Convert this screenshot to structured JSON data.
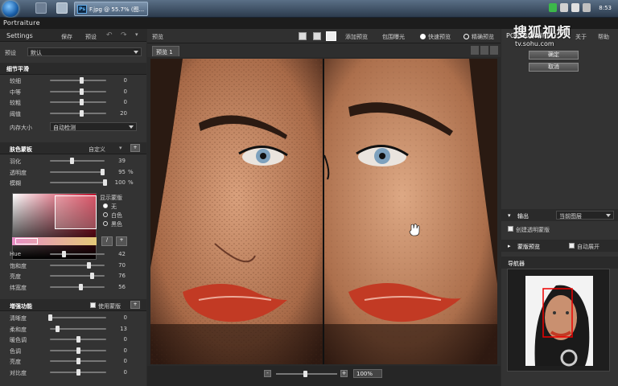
{
  "taskbar": {
    "active_task": "F.jpg @ 55.7% (图...",
    "ps_badge": "Ps",
    "clock": "8:53"
  },
  "app": {
    "title": "Portraiture"
  },
  "settings": {
    "title": "Settings",
    "save": "保存",
    "preset_btn": "预设",
    "preset_label": "预设",
    "preset_value": "默认",
    "detail_header": "细节平滑",
    "detail_sliders": [
      {
        "label": "较细",
        "value": 0,
        "pct": 0.55
      },
      {
        "label": "中等",
        "value": 0,
        "pct": 0.55
      },
      {
        "label": "较粗",
        "value": 0,
        "pct": 0.55
      },
      {
        "label": "阈值",
        "value": 20,
        "pct": 0.55
      }
    ],
    "feature_label": "内存大小",
    "feature_value": "自动检测",
    "mask_header": "肤色蒙板",
    "mask_mode": "自定义",
    "mask_sliders": [
      {
        "label": "羽化",
        "value": 39,
        "unit": "",
        "pct": 0.39
      },
      {
        "label": "透明度",
        "value": 95,
        "unit": "%",
        "pct": 0.95
      },
      {
        "label": "模糊",
        "value": 100,
        "unit": "%",
        "pct": 1.0
      }
    ],
    "show_mask_label": "显示蒙版",
    "show_mask_options": [
      "无",
      "白色",
      "黑色"
    ],
    "show_mask_selected": 0,
    "hsl_sliders": [
      {
        "label": "Hue",
        "value": 42,
        "pct": 0.25
      },
      {
        "label": "饱和度",
        "value": 70,
        "pct": 0.7
      },
      {
        "label": "亮度",
        "value": 76,
        "pct": 0.76
      },
      {
        "label": "纬宽度",
        "value": 56,
        "pct": 0.56
      }
    ],
    "enhance_header": "增强功能",
    "use_mask_label": "使用蒙版",
    "enhance_sliders": [
      {
        "label": "清晰度",
        "value": 0,
        "pct": 0.0
      },
      {
        "label": "柔和度",
        "value": 13,
        "pct": 0.13
      },
      {
        "label": "暖色调",
        "value": 0,
        "pct": 0.5
      },
      {
        "label": "色调",
        "value": 0,
        "pct": 0.5
      },
      {
        "label": "亮度",
        "value": 0,
        "pct": 0.5
      },
      {
        "label": "对比度",
        "value": 0,
        "pct": 0.5
      }
    ]
  },
  "preview": {
    "title": "预览",
    "add_preview": "添加预览",
    "include_bleed": "包围曝光",
    "quick_preview": "快速预览",
    "accurate_preview": "精确预览",
    "tab": "预览 1",
    "zoom": "100%"
  },
  "right_panel": {
    "logo": "PORTRAITURE 2",
    "about": "关于",
    "help": "帮助",
    "ok": "确定",
    "cancel": "取消",
    "output_label": "输出",
    "output_value": "当前图层",
    "create_layer": "创建透明蒙版",
    "mask_preview": "蒙版预览",
    "auto_expand": "自动展开",
    "navigator": "导航器"
  },
  "watermark": {
    "brand": "搜狐视频",
    "url": "tv.sohu.com"
  }
}
